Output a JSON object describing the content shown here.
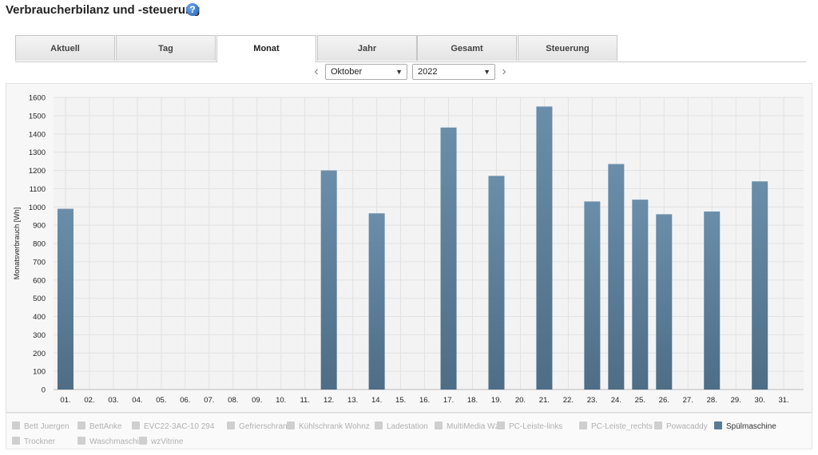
{
  "header": {
    "title": "Verbraucherbilanz und -steuerung",
    "help_icon": "?"
  },
  "tabs": [
    {
      "label": "Aktuell",
      "active": false
    },
    {
      "label": "Tag",
      "active": false
    },
    {
      "label": "Monat",
      "active": true
    },
    {
      "label": "Jahr",
      "active": false
    },
    {
      "label": "Gesamt",
      "active": false
    },
    {
      "label": "Steuerung",
      "active": false
    }
  ],
  "period": {
    "prev_icon": "‹",
    "next_icon": "›",
    "month": "Oktober",
    "year": "2022"
  },
  "colors": {
    "bar_top": "#6a8eaa",
    "bar_bottom": "#4e6d86",
    "legend_active": "#5a7b96",
    "legend_inactive": "#cfcfcf"
  },
  "chart_data": {
    "type": "bar",
    "ylabel": "Monatsverbrauch [Wh]",
    "ylim": [
      0,
      1600
    ],
    "yticks": [
      "0",
      "100",
      "200",
      "300",
      "400",
      "500",
      "600",
      "700",
      "800",
      "900",
      "1000",
      "1100",
      "1200",
      "1300",
      "1400",
      "1500",
      "1600"
    ],
    "grid": true,
    "categories": [
      "01.",
      "02.",
      "03.",
      "04.",
      "05.",
      "06.",
      "07.",
      "08.",
      "09.",
      "10.",
      "11.",
      "12.",
      "13.",
      "14.",
      "15.",
      "16.",
      "17.",
      "18.",
      "19.",
      "20.",
      "21.",
      "22.",
      "23.",
      "24.",
      "25.",
      "26.",
      "27.",
      "28.",
      "29.",
      "30.",
      "31."
    ],
    "series": [
      {
        "name": "Spülmaschine",
        "values": [
          990,
          0,
          0,
          0,
          0,
          0,
          0,
          0,
          0,
          0,
          0,
          1200,
          0,
          965,
          0,
          0,
          1435,
          0,
          1170,
          0,
          1550,
          0,
          1030,
          1235,
          1040,
          960,
          0,
          975,
          0,
          1140,
          0
        ]
      }
    ]
  },
  "legend": [
    {
      "label": "Bett Juergen",
      "active": false
    },
    {
      "label": "BettAnke",
      "active": false
    },
    {
      "label": "EVC22-3AC-10 294",
      "active": false
    },
    {
      "label": "Gefrierschrank",
      "active": false
    },
    {
      "label": "Kühlschrank Wohnz",
      "active": false
    },
    {
      "label": "Ladestation",
      "active": false
    },
    {
      "label": "MultiMedia Wz",
      "active": false
    },
    {
      "label": "PC-Leiste-links",
      "active": false
    },
    {
      "label": "PC-Leiste_rechts",
      "active": false
    },
    {
      "label": "Powacaddy",
      "active": false
    },
    {
      "label": "Spülmaschine",
      "active": true
    },
    {
      "label": "Trockner",
      "active": false
    },
    {
      "label": "Waschmaschine",
      "active": false
    },
    {
      "label": "wzVitrine",
      "active": false
    }
  ]
}
